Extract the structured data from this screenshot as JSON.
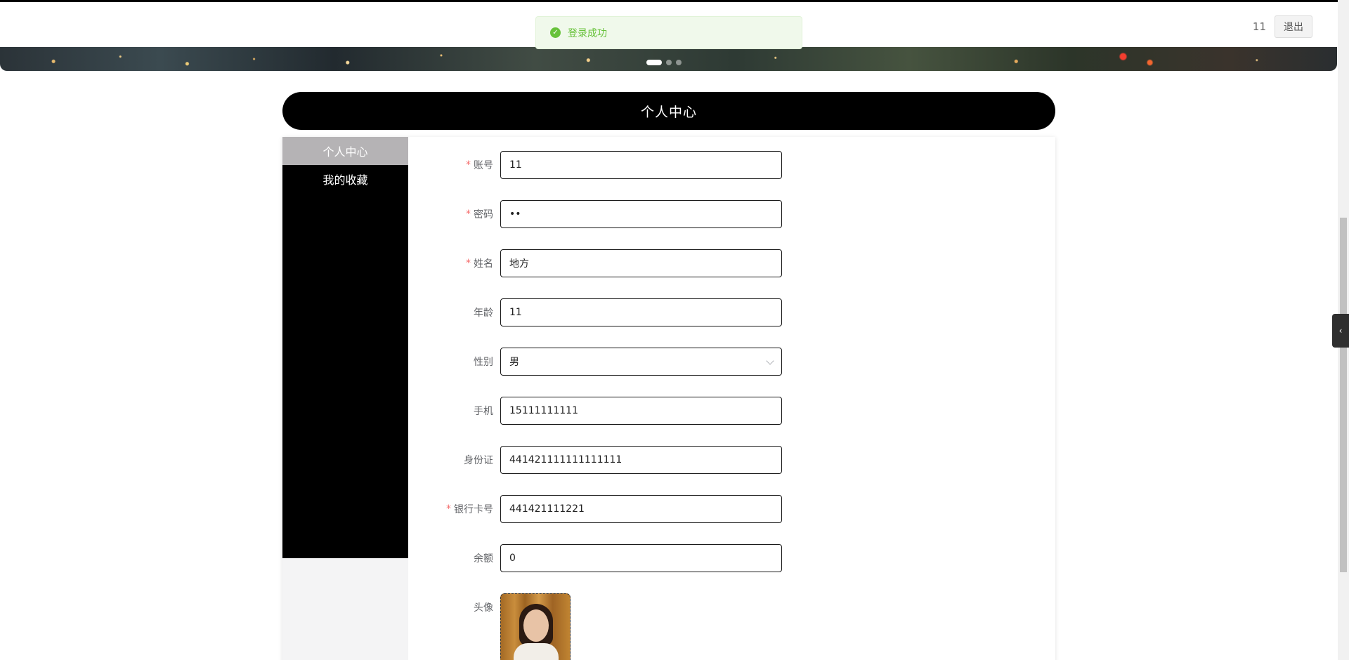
{
  "header": {
    "username": "11",
    "logout_label": "退出"
  },
  "toast": {
    "icon": "check-circle-icon",
    "message": "登录成功",
    "color": "#67c23a"
  },
  "carousel": {
    "dot_count": 3,
    "active_index": 0
  },
  "page": {
    "title": "个人中心"
  },
  "sidebar": {
    "items": [
      {
        "label": "个人中心",
        "active": true
      },
      {
        "label": "我的收藏",
        "active": false
      }
    ]
  },
  "form": {
    "fields": [
      {
        "label": "账号",
        "required": true,
        "value": "11",
        "type": "text"
      },
      {
        "label": "密码",
        "required": true,
        "value": "••",
        "type": "password"
      },
      {
        "label": "姓名",
        "required": true,
        "value": "地方",
        "type": "text"
      },
      {
        "label": "年龄",
        "required": false,
        "value": "11",
        "type": "text"
      },
      {
        "label": "性别",
        "required": false,
        "value": "男",
        "type": "select"
      },
      {
        "label": "手机",
        "required": false,
        "value": "15111111111",
        "type": "text"
      },
      {
        "label": "身份证",
        "required": false,
        "value": "441421111111111111",
        "type": "text"
      },
      {
        "label": "银行卡号",
        "required": true,
        "value": "441421111221",
        "type": "text"
      },
      {
        "label": "余额",
        "required": false,
        "value": "0",
        "type": "text"
      }
    ],
    "avatar_label": "头像",
    "required_mark": "*"
  },
  "side_toggle": {
    "icon": "chevron-left-icon",
    "glyph": "‹"
  },
  "colors": {
    "accent_black": "#000000",
    "active_menu": "#b5b3b5",
    "required": "#f56c6c"
  }
}
